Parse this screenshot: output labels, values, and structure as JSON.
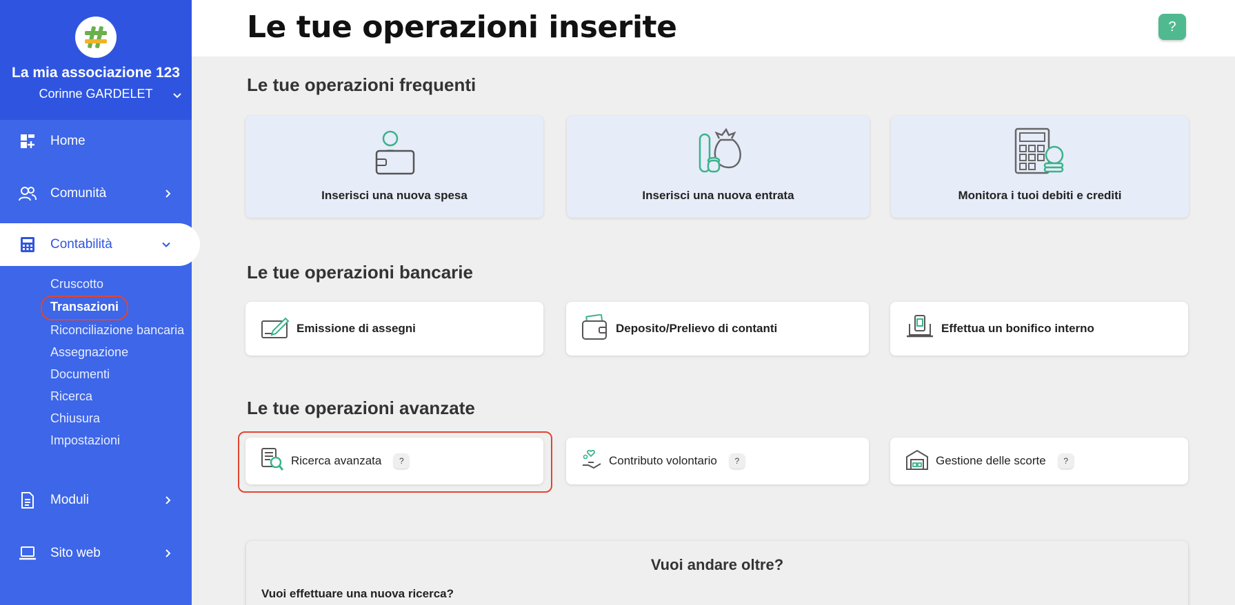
{
  "sidebar": {
    "org_name": "La mia associazione 123",
    "user_name": "Corinne GARDELET",
    "nav": {
      "home": "Home",
      "comunita": "Comunità",
      "contabilita": "Contabilità",
      "moduli": "Moduli",
      "sito_web": "Sito web"
    },
    "submenu": [
      "Cruscotto",
      "Transazioni",
      "Riconciliazione bancaria",
      "Assegnazione",
      "Documenti",
      "Ricerca",
      "Chiusura",
      "Impostazioni"
    ],
    "active_sub": "Transazioni"
  },
  "header": {
    "title": "Le tue operazioni inserite",
    "help_label": "?"
  },
  "sections": {
    "frequent": {
      "title": "Le tue operazioni frequenti",
      "cards": [
        "Inserisci una nuova spesa",
        "Inserisci una nuova entrata",
        "Monitora i tuoi debiti e crediti"
      ]
    },
    "banking": {
      "title": "Le tue operazioni bancarie",
      "cards": [
        "Emissione di assegni",
        "Deposito/Prelievo di contanti",
        "Effettua un bonifico interno"
      ]
    },
    "advanced": {
      "title": "Le tue operazioni avanzate",
      "cards": [
        "Ricerca avanzata",
        "Contributo volontario",
        "Gestione delle scorte"
      ],
      "badge": "?"
    }
  },
  "more": {
    "title": "Vuoi andare oltre?",
    "question": "Vuoi effettuare una nuova ricerca?"
  },
  "colors": {
    "sidebar_bg": "#3d66e8",
    "sidebar_head_bg": "#2f55e0",
    "accent_green": "#50b98f",
    "highlight_red": "#e0452f",
    "card_light_blue": "#e6ecf8"
  }
}
